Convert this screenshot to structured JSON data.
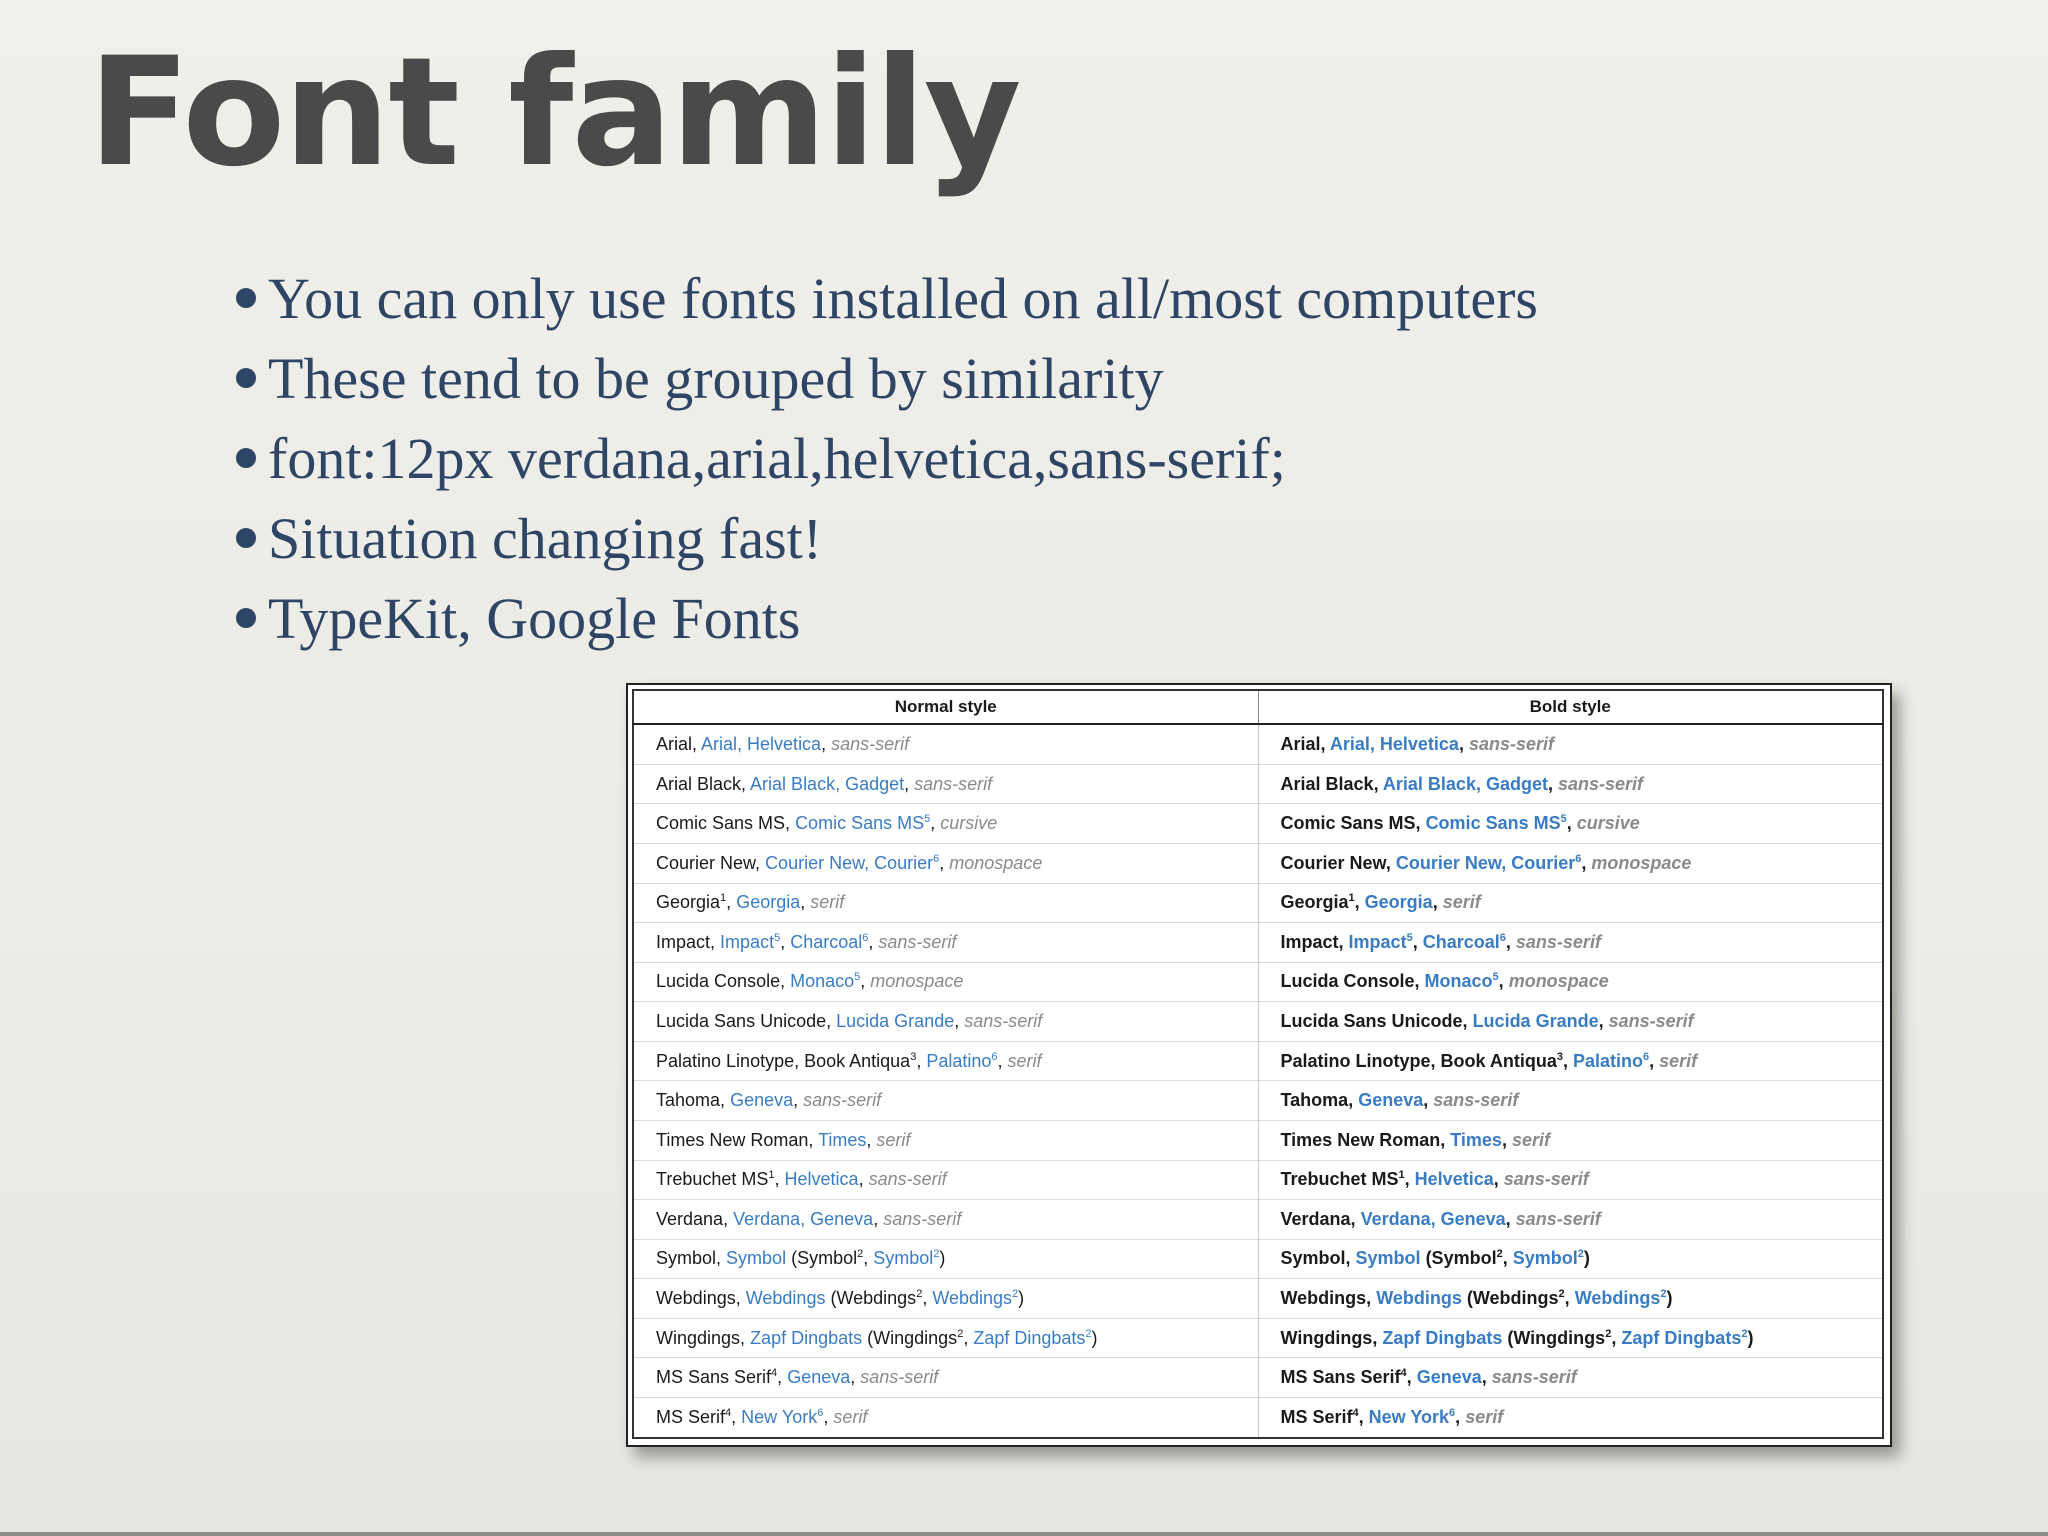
{
  "slide": {
    "title": "Font family",
    "bullets": [
      "You can only use fonts installed on all/most computers",
      "These tend to be grouped by similarity",
      "font:12px verdana,arial,helvetica,sans-serif;",
      "Situation changing fast!",
      "TypeKit, Google Fonts"
    ]
  },
  "table": {
    "headers": [
      "Normal style",
      "Bold style"
    ],
    "rows": [
      {
        "name": "Arial",
        "mac": "Arial, Helvetica",
        "generic": "sans-serif"
      },
      {
        "name": "Arial Black",
        "mac": "Arial Black, Gadget",
        "generic": "sans-serif"
      },
      {
        "name": "Comic Sans MS",
        "mac": "Comic Sans MS",
        "mac_sup": "5",
        "generic": "cursive"
      },
      {
        "name": "Courier New",
        "mac": "Courier New, Courier",
        "mac_sup": "6",
        "generic": "monospace"
      },
      {
        "name": "Georgia",
        "name_sup": "1",
        "mac": "Georgia",
        "generic": "serif"
      },
      {
        "name": "Impact",
        "mac": "Impact",
        "mac_sup": "5",
        "mac2": "Charcoal",
        "mac2_sup": "6",
        "generic": "sans-serif"
      },
      {
        "name": "Lucida Console",
        "mac": "Monaco",
        "mac_sup": "5",
        "generic": "monospace"
      },
      {
        "name": "Lucida Sans Unicode",
        "mac": "Lucida Grande",
        "generic": "sans-serif"
      },
      {
        "name": "Palatino Linotype, Book Antiqua",
        "name_sup": "3",
        "mac": "Palatino",
        "mac_sup": "6",
        "generic": "serif"
      },
      {
        "name": "Tahoma",
        "mac": "Geneva",
        "generic": "sans-serif"
      },
      {
        "name": "Times New Roman",
        "mac": "Times",
        "generic": "serif"
      },
      {
        "name": "Trebuchet MS",
        "name_sup": "1",
        "mac": "Helvetica",
        "generic": "sans-serif"
      },
      {
        "name": "Verdana",
        "mac": "Verdana, Geneva",
        "generic": "sans-serif"
      },
      {
        "name": "Symbol",
        "mac": "Symbol",
        "extra": "(Symbol",
        "extra_sup": "2",
        "extra_mac": "Symbol",
        "extra_mac_sup": "2"
      },
      {
        "name": "Webdings",
        "mac": "Webdings",
        "extra": "(Webdings",
        "extra_sup": "2",
        "extra_mac": "Webdings",
        "extra_mac_sup": "2"
      },
      {
        "name": "Wingdings",
        "mac": "Zapf Dingbats",
        "extra": "(Wingdings",
        "extra_sup": "2",
        "extra_mac": "Zapf Dingbats",
        "extra_mac_sup": "2"
      },
      {
        "name": "MS Sans Serif",
        "name_sup": "4",
        "mac": "Geneva",
        "generic": "sans-serif"
      },
      {
        "name": "MS Serif",
        "name_sup": "4",
        "mac": "New York",
        "mac_sup": "6",
        "generic": "serif"
      }
    ]
  }
}
